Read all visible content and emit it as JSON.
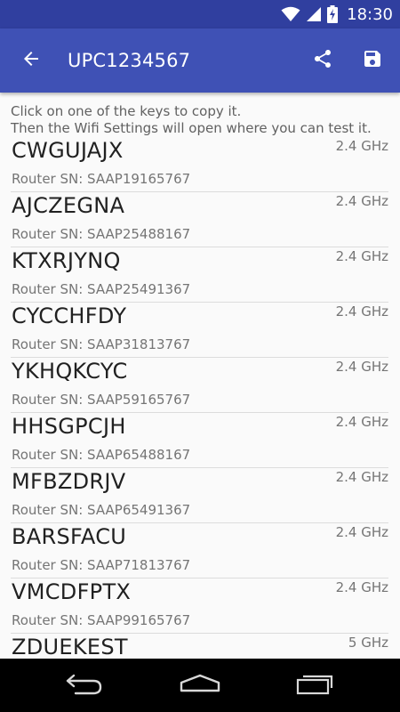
{
  "status_bar": {
    "time": "18:30",
    "color": "#303f9f"
  },
  "toolbar": {
    "title": "UPC1234567",
    "color": "#3f51b5",
    "back_icon": "arrow-back-icon",
    "share_icon": "share-icon",
    "save_icon": "save-icon"
  },
  "instructions": {
    "line1": "Click on one of the keys to copy it.",
    "line2": "Then the Wifi Settings will open where you can test it."
  },
  "keys": [
    {
      "key": "CWGUJAJX",
      "band": "2.4 GHz",
      "serial": "Router SN: SAAP19165767"
    },
    {
      "key": "AJCZEGNA",
      "band": "2.4 GHz",
      "serial": "Router SN: SAAP25488167"
    },
    {
      "key": "KTXRJYNQ",
      "band": "2.4 GHz",
      "serial": "Router SN: SAAP25491367"
    },
    {
      "key": "CYCCHFDY",
      "band": "2.4 GHz",
      "serial": "Router SN: SAAP31813767"
    },
    {
      "key": "YKHQKCYC",
      "band": "2.4 GHz",
      "serial": "Router SN: SAAP59165767"
    },
    {
      "key": "HHSGPCJH",
      "band": "2.4 GHz",
      "serial": "Router SN: SAAP65488167"
    },
    {
      "key": "MFBZDRJV",
      "band": "2.4 GHz",
      "serial": "Router SN: SAAP65491367"
    },
    {
      "key": "BARSFACU",
      "band": "2.4 GHz",
      "serial": "Router SN: SAAP71813767"
    },
    {
      "key": "VMCDFPTX",
      "band": "2.4 GHz",
      "serial": "Router SN: SAAP99165767"
    },
    {
      "key": "ZDUEKEST",
      "band": "5 GHz",
      "serial": ""
    }
  ],
  "nav_bar": {
    "back_icon": "nav-back-icon",
    "home_icon": "nav-home-icon",
    "recents_icon": "nav-recents-icon"
  }
}
